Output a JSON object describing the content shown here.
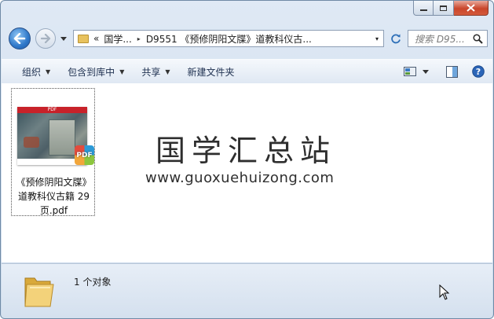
{
  "window": {
    "caption_buttons": [
      {
        "name": "minimize-button",
        "glyph": "–"
      },
      {
        "name": "maximize-button",
        "glyph": "▫"
      },
      {
        "name": "close-button",
        "glyph": "✕"
      }
    ]
  },
  "navigation": {
    "back_icon": "back-arrow-icon",
    "forward_icon": "forward-arrow-icon",
    "recent_dropdown_icon": "chevron-down-icon"
  },
  "address_bar": {
    "overflow": "«",
    "crumbs": [
      "国学...",
      "D9551 《预修阴阳文牒》道教科仪古..."
    ],
    "separator": "▸",
    "dropdown_glyph": "▾"
  },
  "search": {
    "placeholder": "搜索 D95..."
  },
  "toolbar": {
    "organize": "组织",
    "include_in_library": "包含到库中",
    "share": "共享",
    "new_folder": "新建文件夹"
  },
  "content": {
    "file": {
      "thumbnail_header": "PDF",
      "badge": "PDF",
      "name": "《预修阴阳文牒》道教科仪古籍 29页.pdf"
    },
    "watermark": {
      "title": "国学汇总站",
      "url": "www.guoxuehuizong.com"
    }
  },
  "status_bar": {
    "count_text": "1 个对象"
  },
  "colors": {
    "accent": "#2f78c9",
    "pdf_red": "#c8222a",
    "close_red": "#c9462b"
  }
}
